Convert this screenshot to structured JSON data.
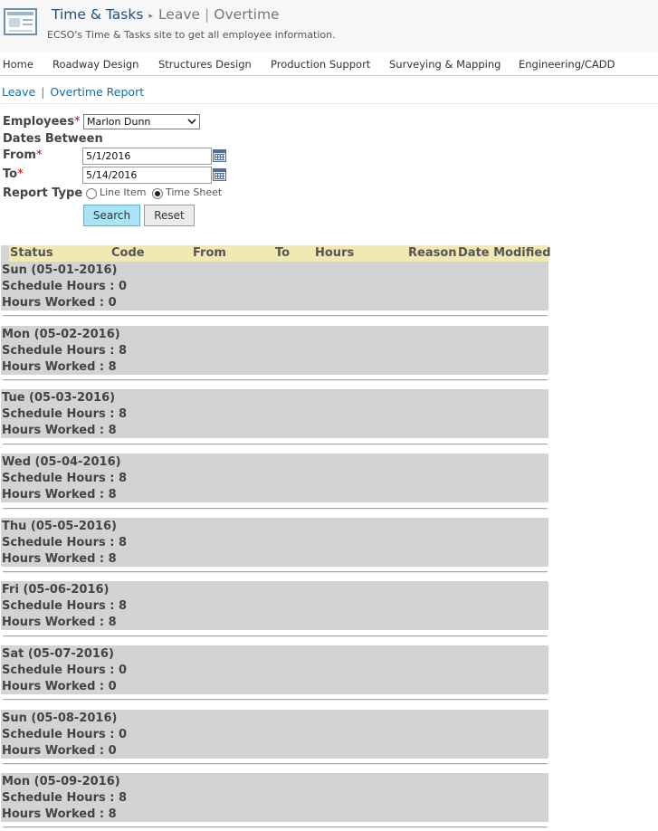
{
  "header": {
    "title": "Time & Tasks",
    "breadcrumb_separator": "▸",
    "breadcrumb_leave": "Leave",
    "breadcrumb_pipe": "|",
    "breadcrumb_overtime": "Overtime",
    "description": "ECSO's Time & Tasks site to get all employee information."
  },
  "nav": {
    "items": [
      {
        "label": "Home"
      },
      {
        "label": "Roadway Design"
      },
      {
        "label": "Structures Design"
      },
      {
        "label": "Production Support"
      },
      {
        "label": "Surveying & Mapping"
      },
      {
        "label": "Engineering/CADD"
      }
    ]
  },
  "quicklinks": {
    "leave": "Leave",
    "pipe": "|",
    "overtime_report": "Overtime Report"
  },
  "form": {
    "employees_label": "Employees",
    "required_mark": "*",
    "employee_selected": "Marlon Dunn",
    "dates_between_label": "Dates Between",
    "from_label": "From",
    "from_value": "5/1/2016",
    "to_label": "To",
    "to_value": "5/14/2016",
    "report_type_label": "Report Type",
    "report_type_options": [
      "Line Item",
      "Time Sheet"
    ],
    "report_type_selected": "Time Sheet",
    "search_button": "Search",
    "reset_button": "Reset"
  },
  "grid": {
    "columns": [
      "Status",
      "Code",
      "From",
      "To",
      "Hours",
      "Reason",
      "Date Modified"
    ],
    "days": [
      {
        "title": "Sun (05-01-2016)",
        "schedule": "Schedule Hours : 0",
        "worked": "Hours Worked : 0"
      },
      {
        "title": "Mon (05-02-2016)",
        "schedule": "Schedule Hours : 8",
        "worked": "Hours Worked : 8"
      },
      {
        "title": "Tue (05-03-2016)",
        "schedule": "Schedule Hours : 8",
        "worked": "Hours Worked : 8"
      },
      {
        "title": "Wed (05-04-2016)",
        "schedule": "Schedule Hours : 8",
        "worked": "Hours Worked : 8"
      },
      {
        "title": "Thu (05-05-2016)",
        "schedule": "Schedule Hours : 8",
        "worked": "Hours Worked : 8"
      },
      {
        "title": "Fri (05-06-2016)",
        "schedule": "Schedule Hours : 8",
        "worked": "Hours Worked : 8"
      },
      {
        "title": "Sat (05-07-2016)",
        "schedule": "Schedule Hours : 0",
        "worked": "Hours Worked : 0"
      },
      {
        "title": "Sun (05-08-2016)",
        "schedule": "Schedule Hours : 0",
        "worked": "Hours Worked : 0"
      },
      {
        "title": "Mon (05-09-2016)",
        "schedule": "Schedule Hours : 8",
        "worked": "Hours Worked : 8"
      }
    ]
  },
  "colors": {
    "title_blue": "#1f4d7f",
    "link_blue": "#0072c6",
    "required_red": "#cc0000",
    "grid_header_bg": "#f1e8b2",
    "day_block_bg": "#d3d3d3",
    "search_button_bg": "#a8e4f6"
  }
}
